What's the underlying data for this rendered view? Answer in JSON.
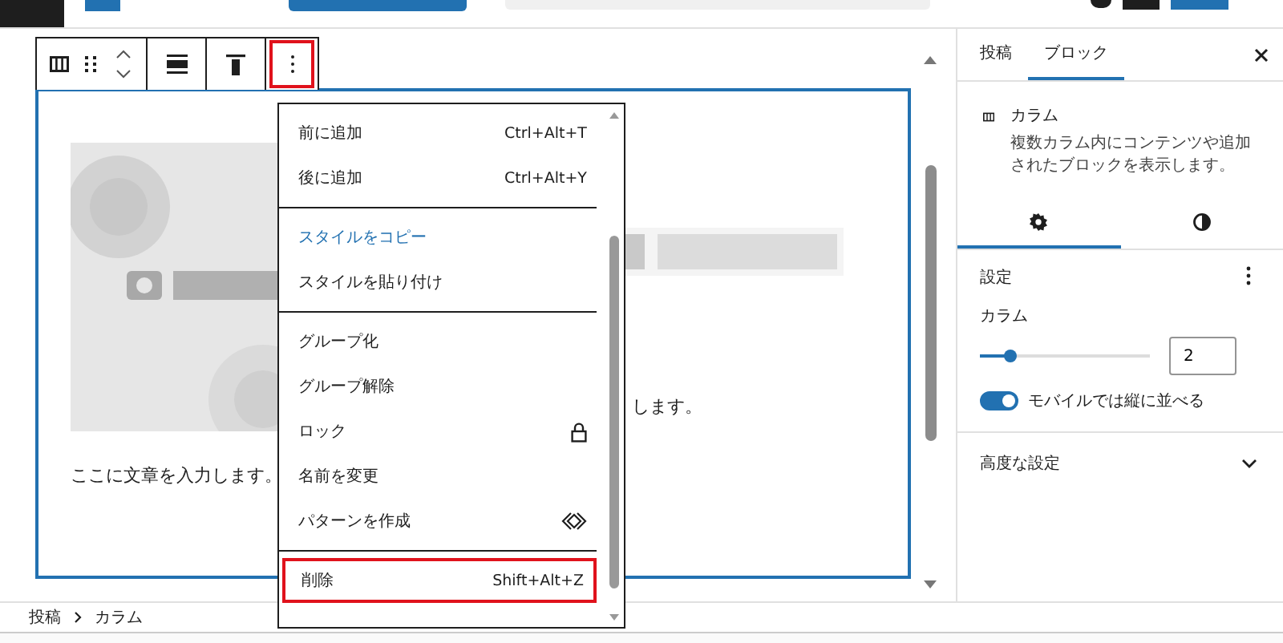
{
  "editor": {
    "paragraph_left": "ここに文章を入力します。",
    "paragraph_right": "します。"
  },
  "menu": {
    "groups": [
      [
        {
          "label": "前に追加",
          "kind": "shortcut",
          "shortcut": "Ctrl+Alt+T",
          "focused": false,
          "annotated": false
        },
        {
          "label": "後に追加",
          "kind": "shortcut",
          "shortcut": "Ctrl+Alt+Y",
          "focused": false,
          "annotated": false
        }
      ],
      [
        {
          "label": "スタイルをコピー",
          "kind": "plain",
          "focused": true,
          "annotated": false
        },
        {
          "label": "スタイルを貼り付け",
          "kind": "plain",
          "focused": false,
          "annotated": false
        }
      ],
      [
        {
          "label": "グループ化",
          "kind": "plain",
          "focused": false,
          "annotated": false
        },
        {
          "label": "グループ解除",
          "kind": "plain",
          "focused": false,
          "annotated": false
        },
        {
          "label": "ロック",
          "kind": "lock",
          "focused": false,
          "annotated": false
        },
        {
          "label": "名前を変更",
          "kind": "plain",
          "focused": false,
          "annotated": false
        },
        {
          "label": "パターンを作成",
          "kind": "pattern",
          "focused": false,
          "annotated": false
        }
      ],
      [
        {
          "label": "削除",
          "kind": "shortcut",
          "shortcut": "Shift+Alt+Z",
          "focused": false,
          "annotated": true
        }
      ]
    ]
  },
  "breadcrumb": [
    "投稿",
    "カラム"
  ],
  "sidebar": {
    "tabs": [
      {
        "label": "投稿",
        "selected": false
      },
      {
        "label": "ブロック",
        "selected": true
      }
    ],
    "block": {
      "title": "カラム",
      "description": "複数カラム内にコンテンツや追加されたブロックを表示します。"
    },
    "subtabs": [
      {
        "kind": "settings",
        "selected": true
      },
      {
        "kind": "styles",
        "selected": false
      }
    ],
    "settings": {
      "title": "設定",
      "columns_label": "カラム",
      "level": 0.18,
      "value": "2",
      "toggle": {
        "label": "モバイルでは縦に並べる",
        "on": true
      }
    },
    "advanced": {
      "title": "高度な設定",
      "expanded": false
    }
  }
}
